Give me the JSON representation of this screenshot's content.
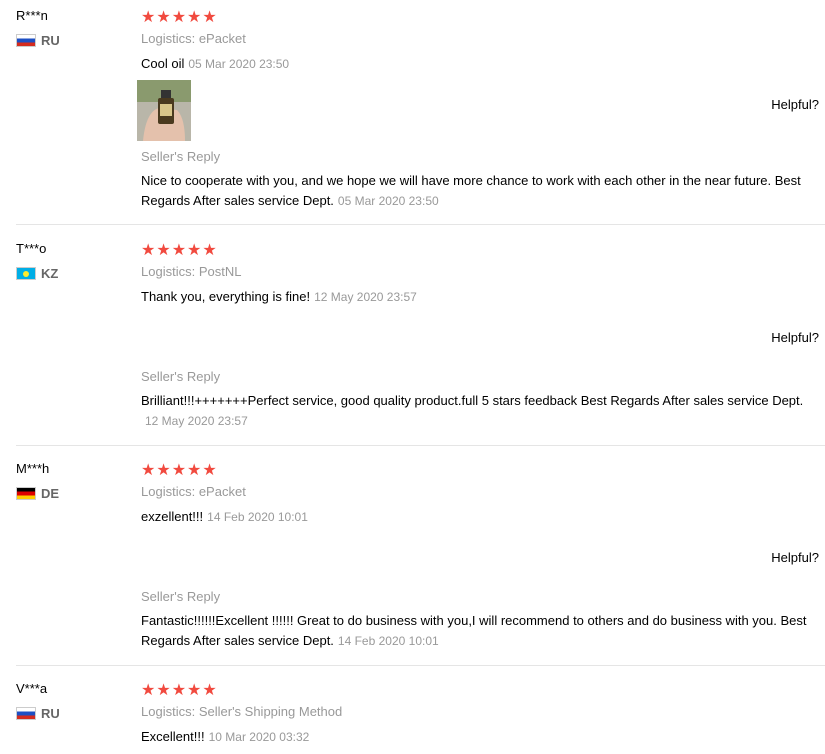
{
  "logistics_label": "Logistics:",
  "seller_reply_label": "Seller's Reply",
  "helpful_label": "Helpful?",
  "star_color": "#f14a3f",
  "reviews": [
    {
      "user": "R***n",
      "country": "RU",
      "rating": 5,
      "logistics": "ePacket",
      "text": "Cool oil",
      "date": "05 Mar 2020 23:50",
      "reply": "Nice to cooperate with you, and we hope we will have more chance to work with each other in the near future. Best Regards After sales service Dept.",
      "reply_date": "05 Mar 2020 23:50"
    },
    {
      "user": "T***o",
      "country": "KZ",
      "rating": 5,
      "logistics": "PostNL",
      "text": "Thank you, everything is fine!",
      "date": "12 May 2020 23:57",
      "reply": "Brilliant!!!+++++++Perfect service, good quality product.full 5 stars feedback Best Regards After sales service Dept.",
      "reply_date": "12 May 2020 23:57"
    },
    {
      "user": "M***h",
      "country": "DE",
      "rating": 5,
      "logistics": "ePacket",
      "text": "exzellent!!!",
      "date": "14 Feb 2020 10:01",
      "reply": "Fantastic!!!!!!Excellent !!!!!! Great to do business with you,I will recommend to others and do business with you. Best Regards After sales service Dept.",
      "reply_date": "14 Feb 2020 10:01"
    },
    {
      "user": "V***a",
      "country": "RU",
      "rating": 5,
      "logistics": "Seller's Shipping Method",
      "text": "Excellent!!!",
      "date": "10 Mar 2020 03:32"
    }
  ]
}
